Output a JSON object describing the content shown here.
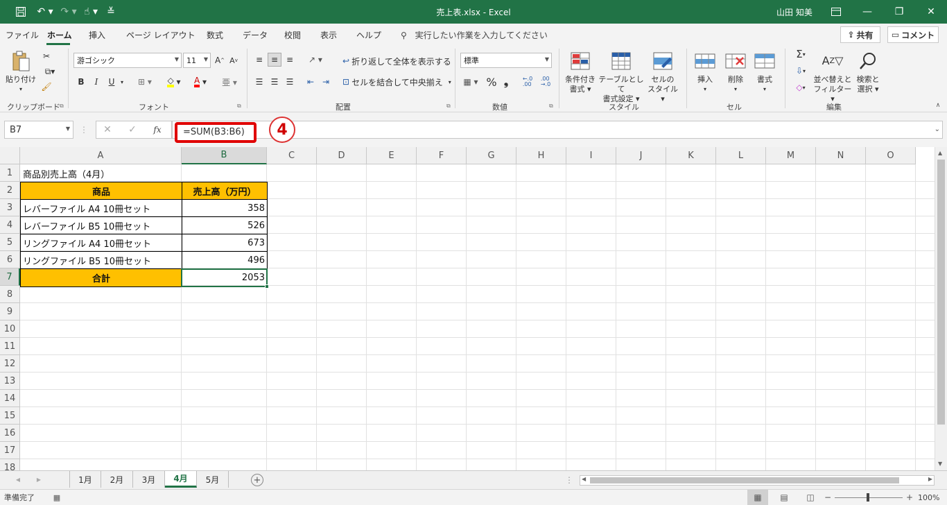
{
  "titlebar": {
    "title": "売上表.xlsx  -  Excel",
    "user": "山田 知美",
    "save_icon": "save-icon",
    "undo_icon": "undo-icon",
    "redo_icon": "redo-icon",
    "touch_icon": "touch-mode-icon"
  },
  "tabs": [
    "ファイル",
    "ホーム",
    "挿入",
    "ページ レイアウト",
    "数式",
    "データ",
    "校閲",
    "表示",
    "ヘルプ"
  ],
  "tell_me": "実行したい作業を入力してください",
  "share_label": "共有",
  "comment_label": "コメント",
  "ribbon": {
    "clipboard": {
      "label": "クリップボード",
      "paste": "貼り付け"
    },
    "font": {
      "label": "フォント",
      "name": "游ゴシック",
      "size": "11",
      "bold": "B",
      "italic": "I",
      "underline": "U"
    },
    "alignment": {
      "label": "配置",
      "wrap": "折り返して全体を表示する",
      "merge": "セルを結合して中央揃え"
    },
    "number": {
      "label": "数値",
      "format": "標準",
      "percent": "%",
      "comma": "❟"
    },
    "styles": {
      "label": "スタイル",
      "cond_line1": "条件付き",
      "cond_line2": "書式",
      "table_line1": "テーブルとして",
      "table_line2": "書式設定",
      "cell_line1": "セルの",
      "cell_line2": "スタイル"
    },
    "cells": {
      "label": "セル",
      "insert": "挿入",
      "delete": "削除",
      "format": "書式"
    },
    "editing": {
      "label": "編集",
      "sort_line1": "並べ替えと",
      "sort_line2": "フィルター",
      "find_line1": "検索と",
      "find_line2": "選択"
    }
  },
  "formula_bar": {
    "namebox": "B7",
    "fx": "fx",
    "formula": "=SUM(B3:B6)",
    "annotation": "4"
  },
  "columns": [
    "A",
    "B",
    "C",
    "D",
    "E",
    "F",
    "G",
    "H",
    "I",
    "J",
    "K",
    "L",
    "M",
    "N",
    "O"
  ],
  "rows": [
    "1",
    "2",
    "3",
    "4",
    "5",
    "6",
    "7",
    "8",
    "9",
    "10",
    "11",
    "12",
    "13",
    "14",
    "15",
    "16",
    "17",
    "18"
  ],
  "sheet": {
    "a1": "商品別売上高（4月）",
    "header_a": "商品",
    "header_b": "売上高（万円）",
    "items": [
      {
        "name": "レバーファイル A4 10冊セット",
        "value": "358"
      },
      {
        "name": "レバーファイル B5 10冊セット",
        "value": "526"
      },
      {
        "name": "リングファイル A4 10冊セット",
        "value": "673"
      },
      {
        "name": "リングファイル B5 10冊セット",
        "value": "496"
      }
    ],
    "total_label": "合計",
    "total_value": "2053"
  },
  "sheet_tabs": [
    "1月",
    "2月",
    "3月",
    "4月",
    "5月"
  ],
  "active_sheet": "4月",
  "status": {
    "ready": "準備完了",
    "zoom": "100%"
  }
}
